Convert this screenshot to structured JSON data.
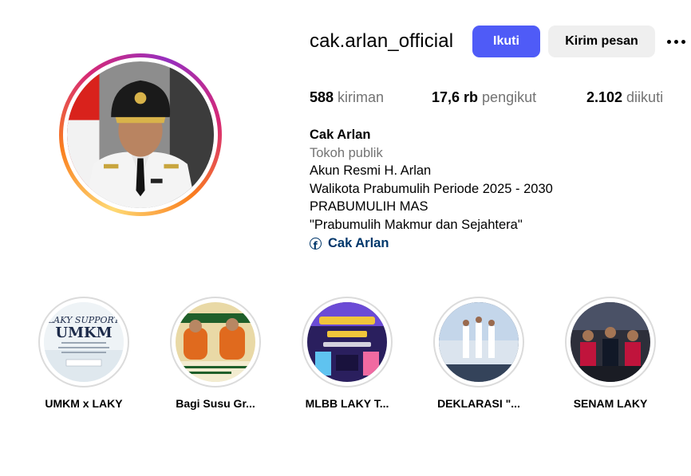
{
  "profile": {
    "username": "cak.arlan_official",
    "follow_label": "Ikuti",
    "message_label": "Kirim pesan"
  },
  "stats": {
    "posts_value": "588",
    "posts_label": "kiriman",
    "followers_value": "17,6 rb",
    "followers_label": "pengikut",
    "following_value": "2.102",
    "following_label": "diikuti"
  },
  "bio": {
    "name": "Cak Arlan",
    "category": "Tokoh publik",
    "lines": [
      "Akun Resmi H. Arlan",
      "Walikota Prabumulih Periode 2025 - 2030",
      "PRABUMULIH MAS",
      "\"Prabumulih Makmur dan Sejahtera\""
    ],
    "link_label": "Cak Arlan",
    "link_icon": "facebook-icon"
  },
  "highlights": [
    {
      "label": "UMKM x LAKY",
      "cover_text_1": "LAKY SUPPORT",
      "cover_text_2": "UMKM"
    },
    {
      "label": "Bagi Susu Gr..."
    },
    {
      "label": "MLBB LAKY T..."
    },
    {
      "label": "DEKLARASI \"..."
    },
    {
      "label": "SENAM LAKY"
    }
  ],
  "colors": {
    "follow_button": "#4f5bf7",
    "message_button": "#efefef",
    "link": "#00376b",
    "muted_text": "#737373",
    "story_ring": [
      "#feda75",
      "#fa7e1e",
      "#d62976",
      "#962fbf"
    ]
  }
}
